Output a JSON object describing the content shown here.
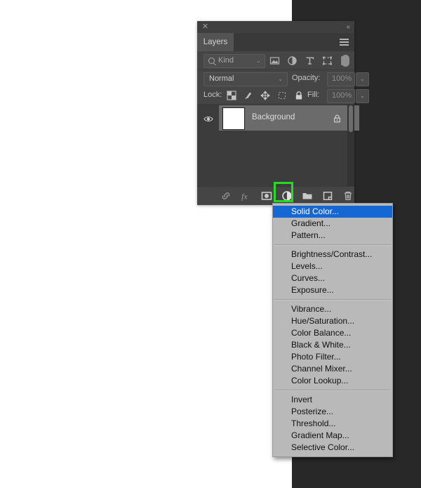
{
  "panel": {
    "close_icon": "close-icon",
    "collapse_icon": "collapse-icon",
    "tab_label": "Layers",
    "menu_icon": "hamburger-icon"
  },
  "filter": {
    "kind_label": "Kind",
    "caret": "⌄",
    "icons": [
      "pixel-layer-filter-icon",
      "adjustment-layer-filter-icon",
      "type-layer-filter-icon",
      "shape-layer-filter-icon",
      "smart-object-filter-icon",
      "filter-toggle-switch"
    ]
  },
  "blend": {
    "mode": "Normal",
    "caret": "⌄",
    "opacity_label": "Opacity:",
    "opacity_value": "100%"
  },
  "lock": {
    "label": "Lock:",
    "icons": [
      "lock-transparency-icon",
      "lock-image-icon",
      "lock-position-icon",
      "lock-artboard-icon",
      "lock-all-icon"
    ],
    "fill_label": "Fill:",
    "fill_value": "100%"
  },
  "layers": [
    {
      "name": "Background",
      "visible": true,
      "locked": true,
      "eye_icon": "eye-icon",
      "lock_icon": "lock-icon"
    }
  ],
  "bottom_toolbar": {
    "icons": [
      "link-layers-icon",
      "layer-style-fx-icon",
      "add-layer-mask-icon",
      "new-adjustment-layer-icon",
      "new-group-icon",
      "new-layer-icon",
      "delete-layer-icon"
    ],
    "highlight_color": "#22dd22",
    "highlighted_icon": "new-adjustment-layer-icon"
  },
  "menu": {
    "selected": "Solid Color...",
    "groups": [
      [
        "Solid Color...",
        "Gradient...",
        "Pattern..."
      ],
      [
        "Brightness/Contrast...",
        "Levels...",
        "Curves...",
        "Exposure..."
      ],
      [
        "Vibrance...",
        "Hue/Saturation...",
        "Color Balance...",
        "Black & White...",
        "Photo Filter...",
        "Channel Mixer...",
        "Color Lookup..."
      ],
      [
        "Invert",
        "Posterize...",
        "Threshold...",
        "Gradient Map...",
        "Selective Color..."
      ]
    ]
  },
  "colors": {
    "panel_bg": "#454545",
    "menu_bg": "#b9b9b9",
    "selection_blue": "#1567d3",
    "highlight_green": "#22dd22"
  }
}
